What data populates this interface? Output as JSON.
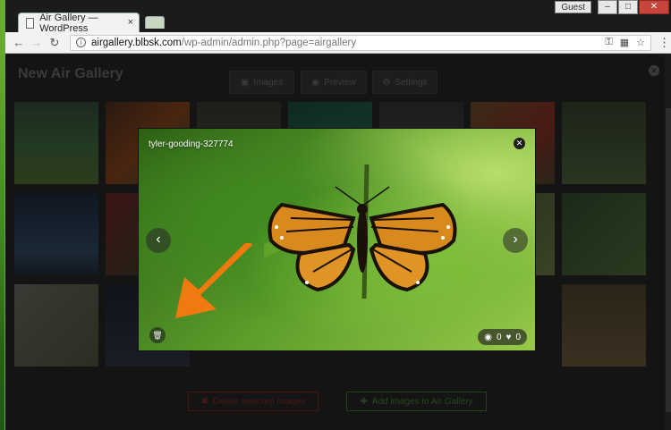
{
  "browser": {
    "tab_title": "Air Gallery — WordPress",
    "tab_close": "×",
    "guest_label": "Guest",
    "url_host": "airgallery.blbsk.com",
    "url_path": "/wp-admin/admin.php?page=airgallery"
  },
  "page": {
    "title": "New Air Gallery",
    "tabs": [
      {
        "label": "Images",
        "icon": "image-icon"
      },
      {
        "label": "Preview",
        "icon": "eye-icon"
      },
      {
        "label": "Settings",
        "icon": "gear-icon"
      }
    ],
    "delete_label": "Delete selected images",
    "add_label": "Add images to Air Gallery"
  },
  "lightbox": {
    "image_name": "tyler-gooding-327774",
    "views": "0",
    "likes": "0"
  },
  "colors": {
    "accent_delete": "#4a1414",
    "accent_add": "#24401a"
  }
}
